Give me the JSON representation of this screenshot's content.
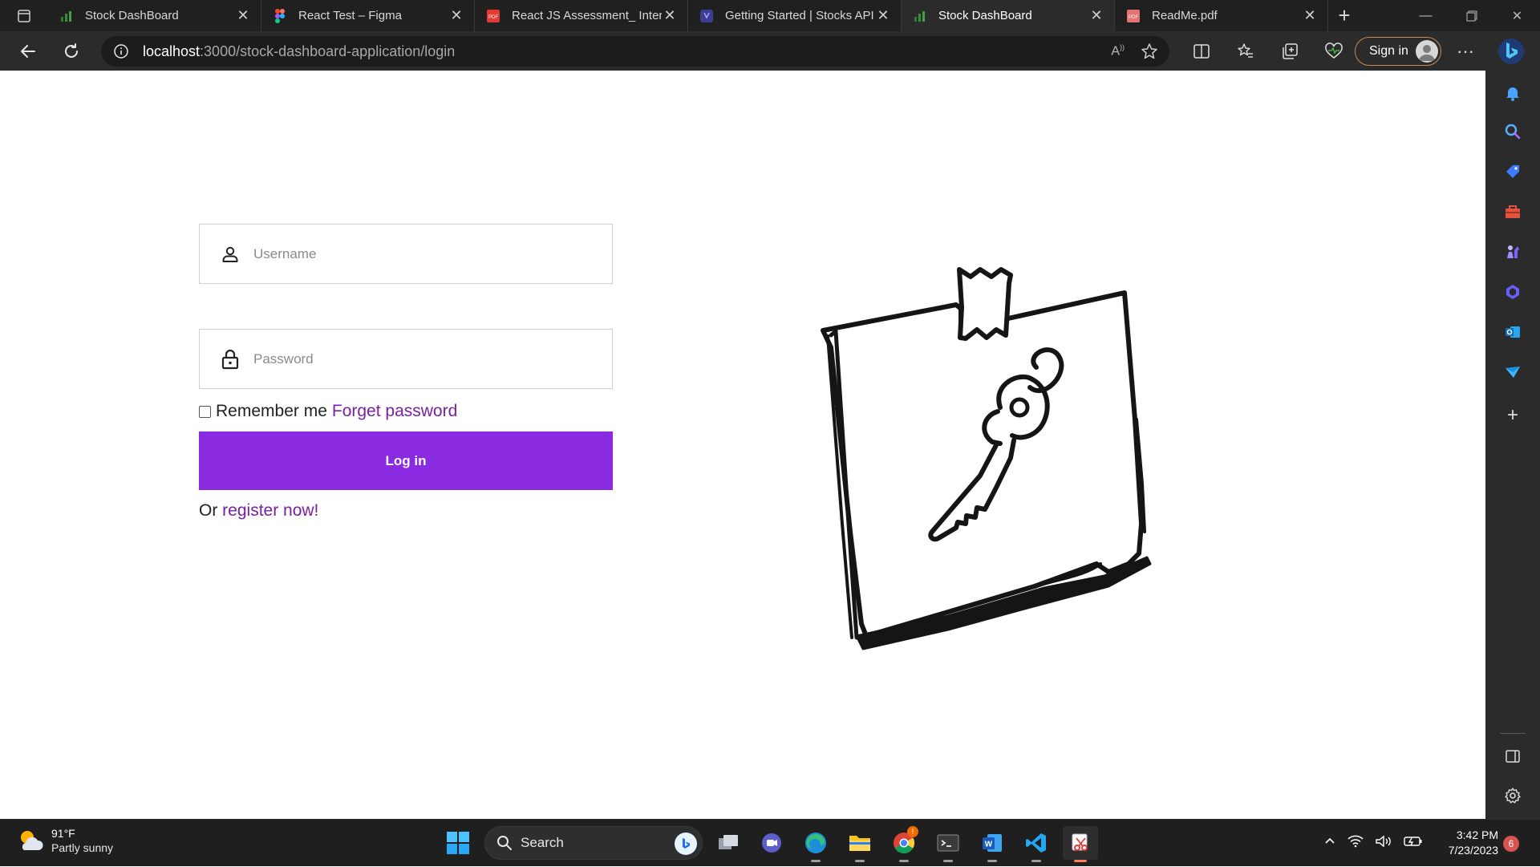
{
  "browser": {
    "tabs": [
      {
        "title": "Stock DashBoard",
        "favicon": "chart-favicon-icon",
        "active": false
      },
      {
        "title": "React Test – Figma",
        "favicon": "figma-icon",
        "active": false
      },
      {
        "title": "React JS Assessment_ Interv",
        "favicon": "pdf-icon",
        "active": false
      },
      {
        "title": "Getting Started | Stocks API",
        "favicon": "api-docs-icon",
        "active": false
      },
      {
        "title": "Stock DashBoard",
        "favicon": "chart-favicon-icon",
        "active": true
      },
      {
        "title": "ReadMe.pdf",
        "favicon": "pdf-icon",
        "active": false
      }
    ],
    "address": {
      "host": "localhost",
      "path": ":3000/stock-dashboard-application/login"
    },
    "signin_label": "Sign in",
    "accent": "#c58a57"
  },
  "login": {
    "username_placeholder": "Username",
    "password_placeholder": "Password",
    "remember_label": "Remember me",
    "forgot_label": "Forget password",
    "login_button": "Log in",
    "register_prefix": "Or",
    "register_link": "register now!",
    "button_color": "#8a2be2",
    "link_color": "#7a1fa2"
  },
  "taskbar": {
    "weather_temp": "91°F",
    "weather_desc": "Partly sunny",
    "search_label": "Search",
    "time": "3:42 PM",
    "date": "7/23/2023",
    "notification_count": "6",
    "chrome_badge": "!"
  }
}
